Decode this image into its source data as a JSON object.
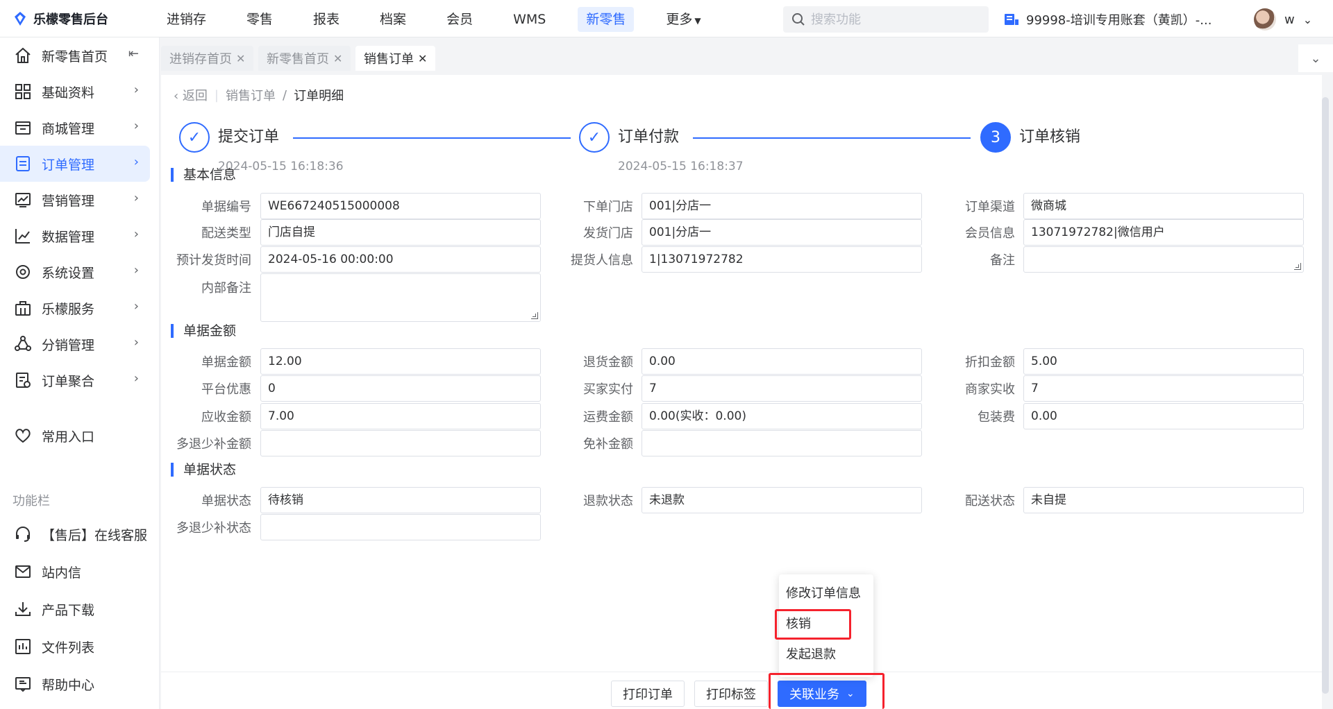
{
  "app": {
    "logo_text": "乐檬零售后台"
  },
  "topnav": {
    "items": [
      "进销存",
      "零售",
      "报表",
      "档案",
      "会员",
      "WMS",
      "新零售",
      "更多"
    ],
    "active_index": 6
  },
  "search": {
    "placeholder": "搜索功能"
  },
  "account": {
    "name": "99998-培训专用账套（黄凯）-...",
    "user_initial": "w"
  },
  "sidebar": {
    "items": [
      {
        "label": "新零售首页",
        "icon": "home-icon",
        "trailing": "collapse-icon"
      },
      {
        "label": "基础资料",
        "icon": "grid-icon"
      },
      {
        "label": "商城管理",
        "icon": "store-icon"
      },
      {
        "label": "订单管理",
        "icon": "order-icon",
        "active": true
      },
      {
        "label": "营销管理",
        "icon": "marketing-icon"
      },
      {
        "label": "数据管理",
        "icon": "chart-icon"
      },
      {
        "label": "系统设置",
        "icon": "settings-icon"
      },
      {
        "label": "乐檬服务",
        "icon": "service-icon"
      },
      {
        "label": "分销管理",
        "icon": "distribution-icon"
      },
      {
        "label": "订单聚合",
        "icon": "aggregate-icon"
      }
    ],
    "favorites": "常用入口",
    "group_title": "功能栏",
    "tools": [
      {
        "label": "【售后】在线客服",
        "icon": "headset-icon"
      },
      {
        "label": "站内信",
        "icon": "mail-icon"
      },
      {
        "label": "产品下载",
        "icon": "download-icon"
      },
      {
        "label": "文件列表",
        "icon": "file-list-icon"
      },
      {
        "label": "帮助中心",
        "icon": "help-icon"
      }
    ]
  },
  "tabs": [
    "进销存首页",
    "新零售首页",
    "销售订单"
  ],
  "breadcrumb": {
    "back": "返回",
    "parent": "销售订单",
    "current": "订单明细"
  },
  "steps": [
    {
      "title": "提交订单",
      "time": "2024-05-15 16:18:36",
      "state": "done"
    },
    {
      "title": "订单付款",
      "time": "2024-05-15 16:18:37",
      "state": "done"
    },
    {
      "title": "订单核销",
      "number": "3",
      "state": "current"
    }
  ],
  "sections": {
    "basic": "基本信息",
    "amount": "单据金额",
    "status": "单据状态"
  },
  "basic": {
    "bill_no_label": "单据编号",
    "bill_no": "WE667240515000008",
    "order_store_label": "下单门店",
    "order_store": "001|分店一",
    "channel_label": "订单渠道",
    "channel": "微商城",
    "delivery_type_label": "配送类型",
    "delivery_type": "门店自提",
    "ship_store_label": "发货门店",
    "ship_store": "001|分店一",
    "member_label": "会员信息",
    "member": "13071972782|微信用户",
    "ship_time_label": "预计发货时间",
    "ship_time": "2024-05-16 00:00:00",
    "pickup_label": "提货人信息",
    "pickup": "1|13071972782",
    "remark_label": "备注",
    "remark": "",
    "internal_remark_label": "内部备注",
    "internal_remark": ""
  },
  "amount": {
    "bill_amount_label": "单据金额",
    "bill_amount": "12.00",
    "return_amount_label": "退货金额",
    "return_amount": "0.00",
    "discount_label": "折扣金额",
    "discount": "5.00",
    "platform_label": "平台优惠",
    "platform": "0",
    "buyer_paid_label": "买家实付",
    "buyer_paid": "7",
    "merchant_recv_label": "商家实收",
    "merchant_recv": "7",
    "receivable_label": "应收金额",
    "receivable": "7.00",
    "freight_label": "运费金额",
    "freight": "0.00(实收：0.00)",
    "packing_label": "包装费",
    "packing": "0.00",
    "refund_adjust_label": "多退少补金额",
    "refund_adjust": "",
    "free_adjust_label": "免补金额",
    "free_adjust": ""
  },
  "status": {
    "bill_status_label": "单据状态",
    "bill_status": "待核销",
    "refund_status_label": "退款状态",
    "refund_status": "未退款",
    "delivery_status_label": "配送状态",
    "delivery_status": "未自提",
    "adjust_status_label": "多退少补状态",
    "adjust_status": ""
  },
  "footer": {
    "print_order": "打印订单",
    "print_label": "打印标签",
    "related": "关联业务"
  },
  "dropdown": [
    "修改订单信息",
    "核销",
    "发起退款"
  ],
  "colors": {
    "primary": "#2f6bff",
    "highlight": "#f5222d"
  }
}
